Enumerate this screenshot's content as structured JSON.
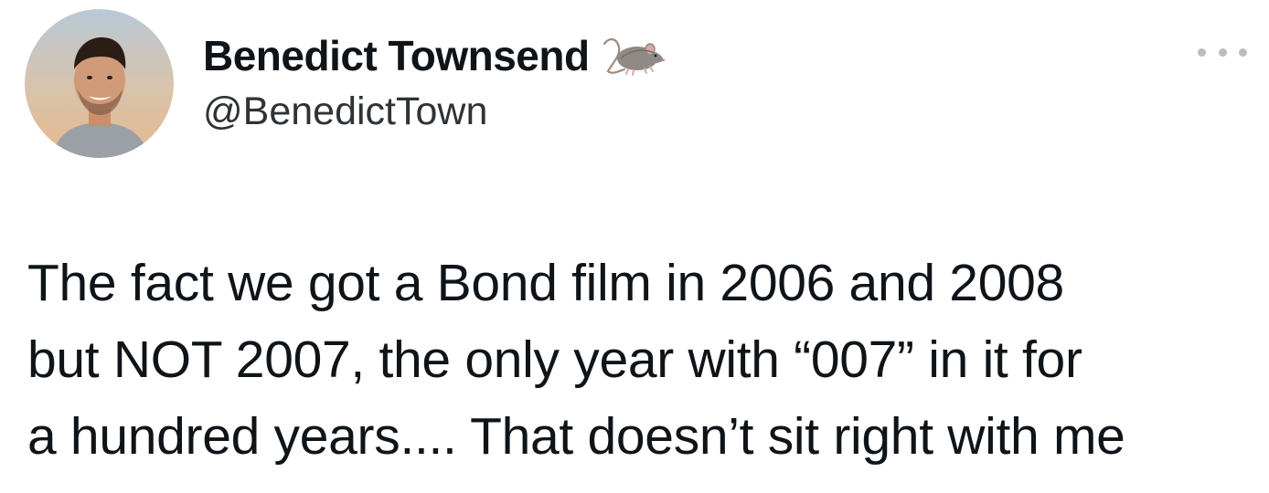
{
  "tweet": {
    "author": {
      "display_name": "Benedict Townsend",
      "handle": "@BenedictTown",
      "name_emoji_icon": "rat-icon",
      "avatar_icon": "profile-photo"
    },
    "more_icon": "ellipsis-icon",
    "text_lines": [
      "The fact we got a Bond film in 2006 and 2008",
      "but NOT 2007, the only year with “007” in it for",
      "a hundred years.... That doesn’t sit right with me"
    ]
  },
  "colors": {
    "text_primary": "#0f1419",
    "text_secondary": "#2f3336",
    "more_dots": "#b9bdc1",
    "background": "#ffffff"
  }
}
